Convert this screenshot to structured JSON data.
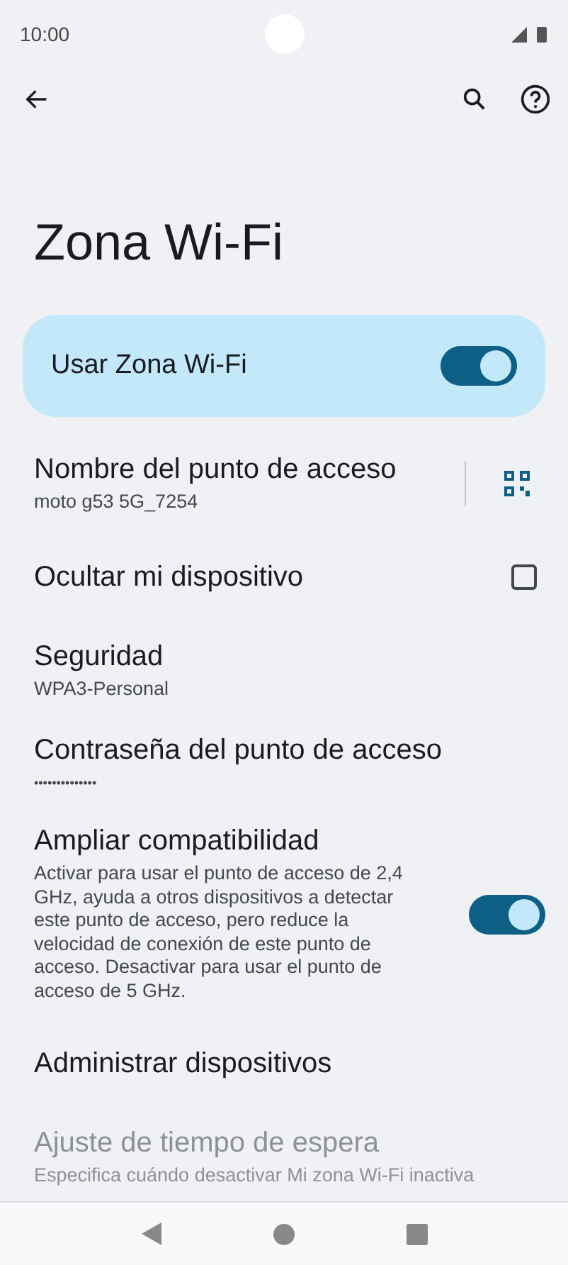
{
  "status_bar": {
    "time": "10:00"
  },
  "title": "Zona Wi-Fi",
  "main_switch": {
    "label": "Usar Zona Wi-Fi",
    "on": true
  },
  "settings": [
    {
      "kind": "qr",
      "title": "Nombre del punto de acceso",
      "subtitle": "moto g53 5G_7254"
    },
    {
      "kind": "checkbox",
      "title": "Ocultar mi dispositivo",
      "checked": false
    },
    {
      "kind": "plain",
      "title": "Seguridad",
      "subtitle": "WPA3-Personal"
    },
    {
      "kind": "password",
      "title": "Contraseña del punto de acceso",
      "subtitle": "••••••••••••••"
    },
    {
      "kind": "switch",
      "title": "Ampliar compatibilidad",
      "subtitle": "Activar para usar el punto de acceso de 2,4 GHz, ayuda a otros dispositivos a detectar este punto de acceso, pero reduce la velocidad de conexión de este punto de acceso. Desactivar para usar el punto de acceso de 5 GHz.",
      "on": true
    },
    {
      "kind": "plain",
      "title": "Administrar dispositivos"
    },
    {
      "kind": "faded",
      "title": "Ajuste de tiempo de espera",
      "subtitle": "Especifica cuándo desactivar Mi zona Wi-Fi inactiva"
    }
  ]
}
